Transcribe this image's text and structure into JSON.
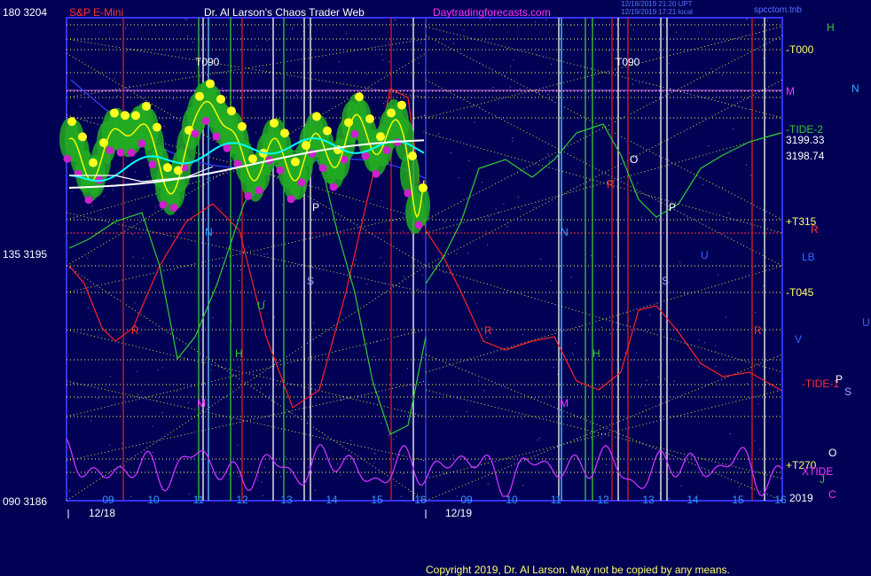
{
  "header": {
    "left_label": "180  3204",
    "symbol": "S&P E-Mini",
    "title": "Dr. Al Larson's Chaos Trader Web",
    "site": "Daytradingforecasts.com",
    "stamp_line1": "12/18/2019 21:20 UPT",
    "stamp_line2": "12/19/2019 17:21 local",
    "file": "spcctom.tnb"
  },
  "footer": {
    "copyright": "Copyright 2019, Dr. Al Larson. May not be copied by any means."
  },
  "chart_data": {
    "type": "line",
    "title": "S&P E-Mini",
    "ylim": [
      3186,
      3204
    ],
    "y_ticks": [
      {
        "value": 3204,
        "label": "180  3204"
      },
      {
        "value": 3195,
        "label": "135  3195"
      },
      {
        "value": 3186,
        "label": "090  3186"
      }
    ],
    "sessions": [
      {
        "date": "12/18",
        "hours": [
          "09",
          "10",
          "11",
          "12",
          "13",
          "14",
          "15",
          "16"
        ]
      },
      {
        "date": "12/19",
        "hours": [
          "09",
          "10",
          "11",
          "12",
          "13",
          "14",
          "15",
          "16"
        ]
      }
    ],
    "price_markers": [
      {
        "label": "3199.33",
        "value": 3199.33
      },
      {
        "label": "3198.74",
        "value": 3198.74
      }
    ],
    "right_labels": [
      {
        "text": "H",
        "color": "#33cc33"
      },
      {
        "text": "-T000",
        "color": "#ffff66"
      },
      {
        "text": "M",
        "color": "#ff33ff"
      },
      {
        "text": "N",
        "color": "#33aaff"
      },
      {
        "text": "-TIDE-2",
        "color": "#33cc33"
      },
      {
        "text": "+T315",
        "color": "#ffff66"
      },
      {
        "text": "R",
        "color": "#ff3333"
      },
      {
        "text": "LB",
        "color": "#3366ff"
      },
      {
        "text": "-T045",
        "color": "#ffff66"
      },
      {
        "text": "U",
        "color": "#3366ff"
      },
      {
        "text": "V",
        "color": "#3366ff"
      },
      {
        "text": "-TIDE-1",
        "color": "#ff3333"
      },
      {
        "text": "P",
        "color": "#ffffff"
      },
      {
        "text": "S",
        "color": "#aaaaff"
      },
      {
        "text": "O",
        "color": "#ffffff"
      },
      {
        "text": "+T270",
        "color": "#ffff66"
      },
      {
        "text": "XTIDE",
        "color": "#ff33ff"
      },
      {
        "text": "J",
        "color": "#33cc33"
      },
      {
        "text": "2019",
        "color": "#ffffff"
      },
      {
        "text": "C",
        "color": "#ff33ff"
      }
    ],
    "plot_annotations": [
      {
        "text": "T090",
        "color": "#ffffff"
      },
      {
        "text": "T090",
        "color": "#ffffff"
      },
      {
        "text": "N",
        "color": "#33aaff"
      },
      {
        "text": "N",
        "color": "#33aaff"
      },
      {
        "text": "P",
        "color": "#ffffff"
      },
      {
        "text": "P",
        "color": "#ffffff"
      },
      {
        "text": "S",
        "color": "#aaaaff"
      },
      {
        "text": "S",
        "color": "#aaaaff"
      },
      {
        "text": "O",
        "color": "#ffffff"
      },
      {
        "text": "U",
        "color": "#33cc33"
      },
      {
        "text": "U",
        "color": "#3366ff"
      },
      {
        "text": "H",
        "color": "#33cc33"
      },
      {
        "text": "H",
        "color": "#33cc33"
      },
      {
        "text": "M",
        "color": "#ff33ff"
      },
      {
        "text": "M",
        "color": "#ff33ff"
      },
      {
        "text": "R",
        "color": "#ff3333"
      },
      {
        "text": "R",
        "color": "#ff3333"
      },
      {
        "text": "R",
        "color": "#ff3333"
      },
      {
        "text": "R",
        "color": "#ff3333"
      }
    ],
    "colors": {
      "background": "#000055",
      "frame": "#3333ff",
      "price": "#ffff00",
      "avg_fast": "#00ffff",
      "avg_slow": "#ffffff",
      "red_flow": "#ff2222",
      "green_flow": "#33cc33",
      "blue_flow": "#3344ff",
      "oscillator": "#cc33ff",
      "time_lines": "#ffffff"
    }
  }
}
